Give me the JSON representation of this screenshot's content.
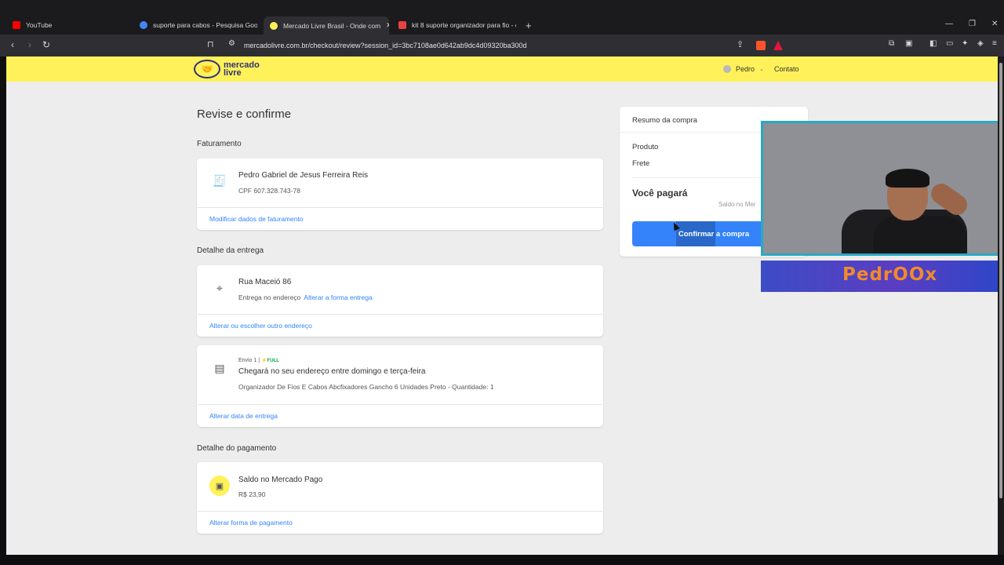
{
  "browser": {
    "tabs": [
      {
        "title": "YouTube",
        "favicon_color": "#ff0000"
      },
      {
        "title": "suporte para cabos - Pesquisa Google",
        "favicon_color": "#4285f4"
      },
      {
        "title": "Mercado Livre Brasil - Onde com",
        "favicon_color": "#fff159",
        "active": true
      },
      {
        "title": "kit 8 suporte organizador para fio - c",
        "favicon_color": "#e94242"
      }
    ],
    "close_tab": "✕",
    "new_tab": "+",
    "url": "mercadolivre.com.br/checkout/review?session_id=3bc7108ae0d642ab9dc4d09320ba300d"
  },
  "header": {
    "logo_line1": "mercado",
    "logo_line2": "livre",
    "user_name": "Pedro",
    "contact": "Contato"
  },
  "page": {
    "title": "Revise e confirme",
    "billing": {
      "section": "Faturamento",
      "name": "Pedro Gabriel de Jesus Ferreira Reis",
      "cpf": "CPF 607.328.743-78",
      "link": "Modificar dados de faturamento"
    },
    "delivery": {
      "section": "Detalhe da entrega",
      "address": "Rua Maceió 86",
      "mode": "Entrega no endereço",
      "mode_link": "Alterar a forma entrega",
      "link": "Alterar ou escolher outro endereço"
    },
    "shipment": {
      "label": "Envio 1 |",
      "full": "⚡FULL",
      "eta": "Chegará no seu endereço entre domingo e terça-feira",
      "item": "Organizador De Fios E Cabos Abcfixadores Gancho 6 Unidades Preto - Quantidade: 1",
      "link": "Alterar data de entrega"
    },
    "payment": {
      "section": "Detalhe do pagamento",
      "method": "Saldo no Mercado Pago",
      "amount": "R$ 23,90",
      "link": "Alterar forma de pagamento"
    }
  },
  "summary": {
    "title": "Resumo da compra",
    "product": "Produto",
    "shipping": "Frete",
    "you_pay": "Você pagará",
    "saldo": "Saldo no Mer",
    "confirm": "Confirmar a compra"
  },
  "overlay": {
    "streamer_logo": "PedrOOx"
  },
  "colors": {
    "ml_yellow": "#fff159",
    "ml_blue": "#3483fa",
    "webcam_border": "#28a9c4"
  }
}
